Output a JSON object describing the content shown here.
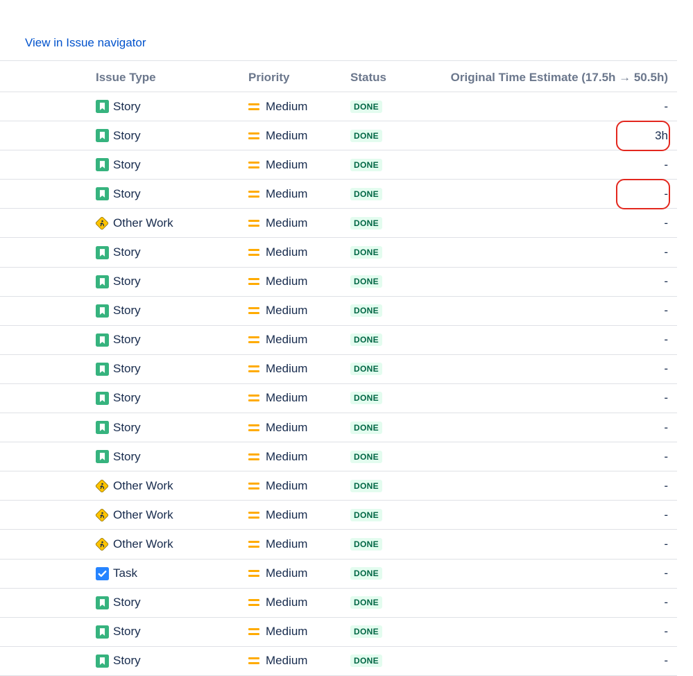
{
  "nav": {
    "link_label": "View in Issue navigator"
  },
  "table": {
    "headers": {
      "issue_type": "Issue Type",
      "priority": "Priority",
      "status": "Status",
      "estimate": "Original Time Estimate (17.5h → 50.5h)"
    },
    "rows": [
      {
        "type": "Story",
        "icon": "story-icon",
        "priority": "Medium",
        "status": "DONE",
        "estimate": "-"
      },
      {
        "type": "Story",
        "icon": "story-icon",
        "priority": "Medium",
        "status": "DONE",
        "estimate": "3h",
        "highlighted": true
      },
      {
        "type": "Story",
        "icon": "story-icon",
        "priority": "Medium",
        "status": "DONE",
        "estimate": "-"
      },
      {
        "type": "Story",
        "icon": "story-icon",
        "priority": "Medium",
        "status": "DONE",
        "estimate": "-",
        "highlighted": true
      },
      {
        "type": "Other Work",
        "icon": "other-work-icon",
        "priority": "Medium",
        "status": "DONE",
        "estimate": "-"
      },
      {
        "type": "Story",
        "icon": "story-icon",
        "priority": "Medium",
        "status": "DONE",
        "estimate": "-"
      },
      {
        "type": "Story",
        "icon": "story-icon",
        "priority": "Medium",
        "status": "DONE",
        "estimate": "-"
      },
      {
        "type": "Story",
        "icon": "story-icon",
        "priority": "Medium",
        "status": "DONE",
        "estimate": "-"
      },
      {
        "type": "Story",
        "icon": "story-icon",
        "priority": "Medium",
        "status": "DONE",
        "estimate": "-"
      },
      {
        "type": "Story",
        "icon": "story-icon",
        "priority": "Medium",
        "status": "DONE",
        "estimate": "-"
      },
      {
        "type": "Story",
        "icon": "story-icon",
        "priority": "Medium",
        "status": "DONE",
        "estimate": "-"
      },
      {
        "type": "Story",
        "icon": "story-icon",
        "priority": "Medium",
        "status": "DONE",
        "estimate": "-"
      },
      {
        "type": "Story",
        "icon": "story-icon",
        "priority": "Medium",
        "status": "DONE",
        "estimate": "-"
      },
      {
        "type": "Other Work",
        "icon": "other-work-icon",
        "priority": "Medium",
        "status": "DONE",
        "estimate": "-"
      },
      {
        "type": "Other Work",
        "icon": "other-work-icon",
        "priority": "Medium",
        "status": "DONE",
        "estimate": "-"
      },
      {
        "type": "Other Work",
        "icon": "other-work-icon",
        "priority": "Medium",
        "status": "DONE",
        "estimate": "-"
      },
      {
        "type": "Task",
        "icon": "task-icon",
        "priority": "Medium",
        "status": "DONE",
        "estimate": "-"
      },
      {
        "type": "Story",
        "icon": "story-icon",
        "priority": "Medium",
        "status": "DONE",
        "estimate": "-"
      },
      {
        "type": "Story",
        "icon": "story-icon",
        "priority": "Medium",
        "status": "DONE",
        "estimate": "-"
      },
      {
        "type": "Story",
        "icon": "story-icon",
        "priority": "Medium",
        "status": "DONE",
        "estimate": "-"
      }
    ]
  },
  "colors": {
    "link": "#0052cc",
    "story": "#36b37e",
    "task": "#2684ff",
    "other_work": "#ffc400",
    "priority_medium": "#ffab00",
    "status_done_bg": "#e3fcef",
    "status_done_text": "#006644",
    "highlight": "#e3271e"
  }
}
